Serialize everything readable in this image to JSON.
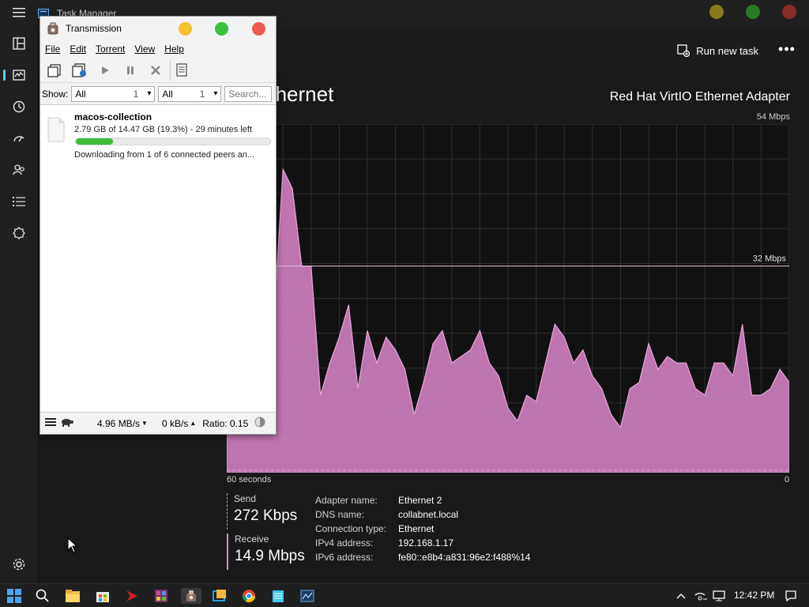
{
  "task_manager": {
    "title": "Task Manager",
    "run_new_task": "Run new task",
    "section_title": "Ethernet",
    "adapter": "Red Hat VirtIO Ethernet Adapter",
    "graph": {
      "y_max_label": "54 Mbps",
      "mid_label": "32 Mbps",
      "x_left_label": "60 seconds",
      "x_right_label": "0",
      "y_max_mbps": 54,
      "mid_mbps": 32,
      "fill_color": "#c77bb7",
      "receive_mbps": [
        44,
        42,
        41,
        16,
        20,
        23,
        47,
        44,
        32,
        32,
        12,
        17,
        21,
        26,
        13,
        22,
        17,
        21,
        19,
        16,
        9,
        14,
        20,
        22,
        17,
        18,
        19,
        22,
        17,
        15,
        10,
        8,
        12,
        11,
        17,
        23,
        21,
        17,
        19,
        15,
        13,
        9,
        7,
        13,
        14,
        20,
        16,
        18,
        17,
        17,
        13,
        12,
        17,
        17,
        15,
        23,
        12,
        12,
        13,
        16,
        14
      ]
    },
    "send": {
      "label": "Send",
      "value": "272 Kbps"
    },
    "receive": {
      "label": "Receive",
      "value": "14.9 Mbps"
    },
    "properties": [
      {
        "key": "Adapter name:",
        "value": "Ethernet 2"
      },
      {
        "key": "DNS name:",
        "value": "collabnet.local"
      },
      {
        "key": "Connection type:",
        "value": "Ethernet"
      },
      {
        "key": "IPv4 address:",
        "value": "192.168.1.17"
      },
      {
        "key": "IPv6 address:",
        "value": "fe80::e8b4:a831:96e2:f488%14"
      }
    ],
    "window_dot_colors": [
      "#8a7a1c",
      "#2b7a2b",
      "#8a2b2b"
    ]
  },
  "transmission": {
    "title": "Transmission",
    "menu": [
      "File",
      "Edit",
      "Torrent",
      "View",
      "Help"
    ],
    "show_label": "Show:",
    "filter1": {
      "value": "All",
      "count": "1"
    },
    "filter2": {
      "value": "All",
      "count": "1"
    },
    "search_placeholder": "Search...",
    "torrent": {
      "name": "macos-collection",
      "progress_text": "2.79 GB of 14.47 GB (19.3%) - 29 minutes left",
      "progress_fraction": 0.193,
      "status": "Downloading from 1 of 6 connected peers an..."
    },
    "statusbar": {
      "down": "4.96 MB/s",
      "up": "0 kB/s",
      "ratio": "Ratio: 0.15"
    },
    "dot_colors": [
      "#f5c12c",
      "#36c23a",
      "#ee5a51"
    ]
  },
  "taskbar": {
    "time": "12:42 PM"
  }
}
